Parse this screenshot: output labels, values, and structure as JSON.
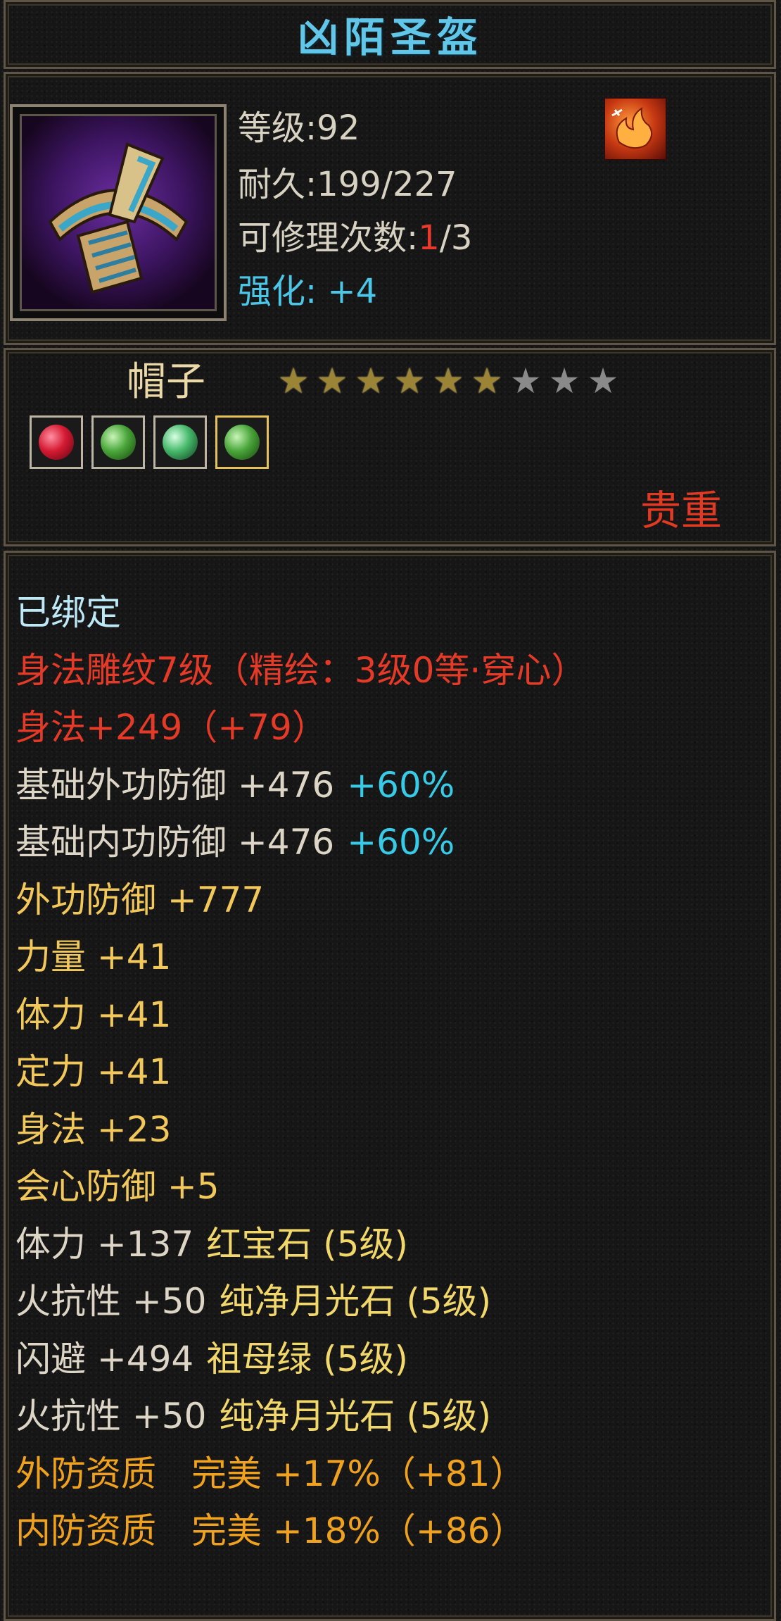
{
  "item": {
    "name": "凶陌圣盔",
    "level_label": "等级:92",
    "durability_label": "耐久:199/227",
    "repair_label_prefix": "可修理次数:",
    "repair_used": "1",
    "repair_total": "/3",
    "strengthen_label": "强化: +4",
    "type": "帽子",
    "rarity": "贵重",
    "stars": {
      "filled": 6,
      "total": 9
    },
    "gem_slots": [
      {
        "icon": "ruby-gem-icon",
        "color": "red",
        "active": false
      },
      {
        "icon": "moonstone-gem-icon",
        "color": "green",
        "active": false
      },
      {
        "icon": "emerald-gem-icon",
        "color": "teal",
        "active": false
      },
      {
        "icon": "moonstone-gem-icon",
        "color": "green",
        "active": true
      }
    ]
  },
  "attributes": {
    "bound": "已绑定",
    "engrave": "身法雕纹7级（精绘：3级0等·穿心）",
    "shenfa_engrave": "身法+249（+79）",
    "base_outer_def": "基础外功防御 +476",
    "base_outer_def_pct": "+60%",
    "base_inner_def": "基础内功防御 +476",
    "base_inner_def_pct": "+60%",
    "outer_def": "外功防御 +777",
    "strength": "力量 +41",
    "stamina": "体力 +41",
    "focus": "定力 +41",
    "agility": "身法 +23",
    "crit_def": "会心防御 +5",
    "gem1": {
      "stat": "体力 +137",
      "gem": "红宝石 (5级)"
    },
    "gem2": {
      "stat": "火抗性 +50",
      "gem": "纯净月光石 (5级)"
    },
    "gem3": {
      "stat": "闪避 +494",
      "gem": "祖母绿 (5级)"
    },
    "gem4": {
      "stat": "火抗性 +50",
      "gem": "纯净月光石 (5级)"
    },
    "outer_quality": "外防资质　完美 +17%（+81）",
    "inner_quality": "内防资质　完美 +18%（+86）"
  },
  "colors": {
    "title": "#61c6e8",
    "rarity": "#e23a22",
    "star_on": "#9b8436",
    "star_off": "#8a8a8a"
  }
}
